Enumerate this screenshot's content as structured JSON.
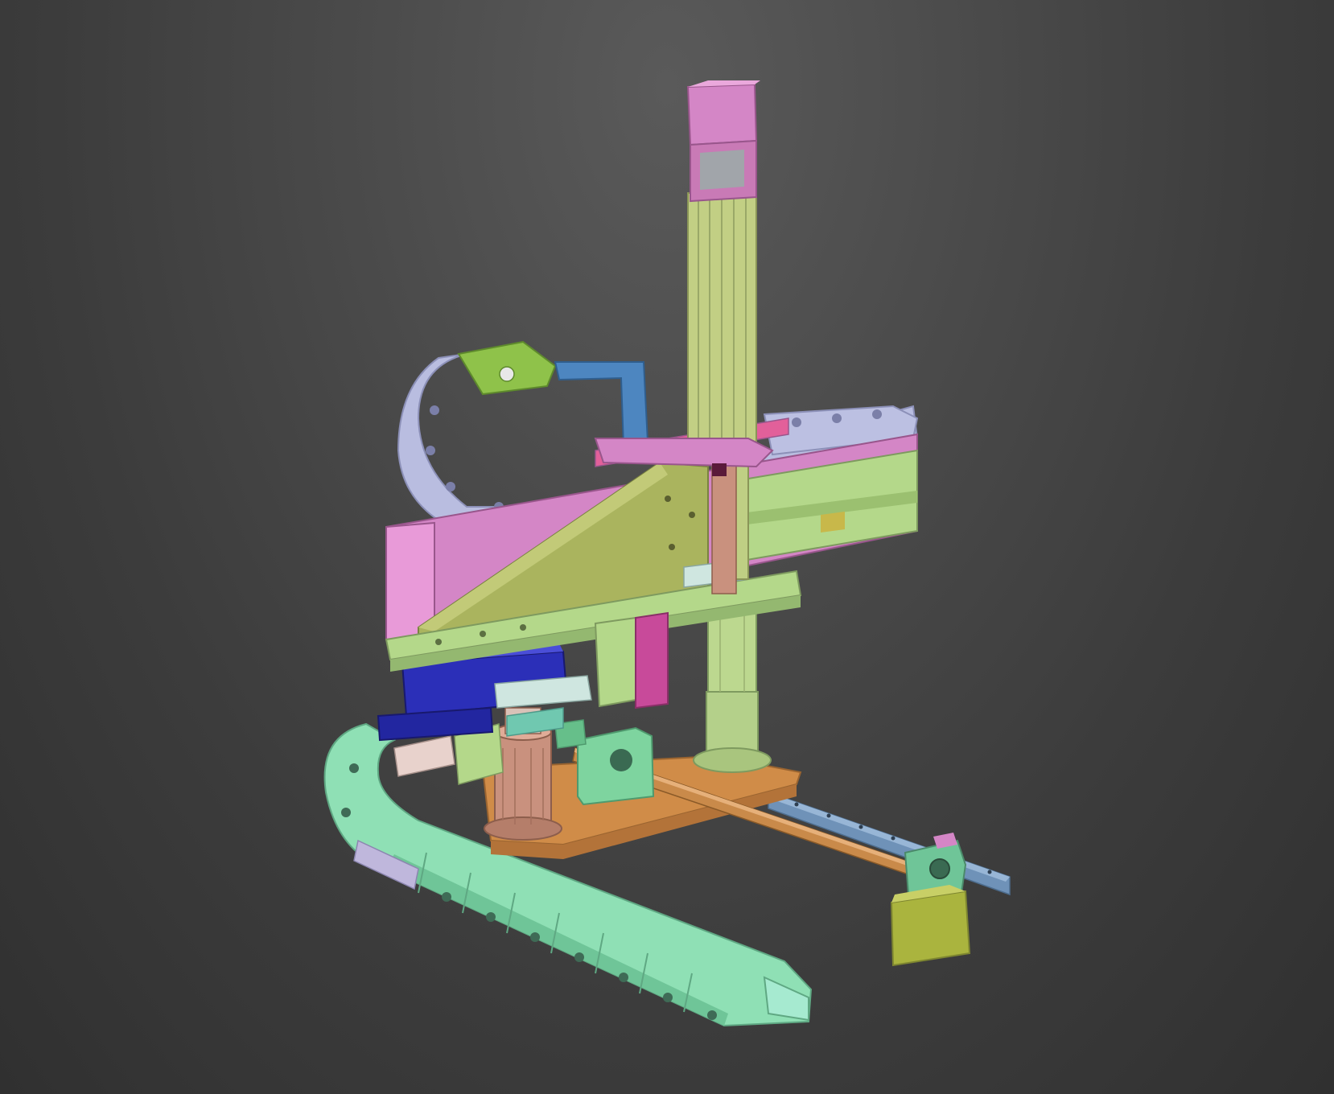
{
  "viewport": {
    "background_top": "#5a5a5a",
    "background_bottom": "#303030"
  },
  "model": {
    "parts": [
      "cable-chain-upper",
      "cable-chain-lower",
      "horizontal-beam",
      "vertical-column",
      "servo-motor",
      "gusset-plate",
      "mounting-plate",
      "linear-guide-rail",
      "ball-screw",
      "bearing-block",
      "carriage-base",
      "cylinder-block",
      "end-block"
    ],
    "colors": {
      "mint": "#8fe0b5",
      "lavender": "#b9bde0",
      "pink": "#d486c6",
      "olive": "#aab45e",
      "pale_green": "#b4d88a",
      "orange": "#d08c48",
      "blue": "#2b2fb8",
      "steel_blue": "#4d86c0",
      "bronze": "#c9917e",
      "yellow_olive": "#b9bd4a"
    }
  }
}
